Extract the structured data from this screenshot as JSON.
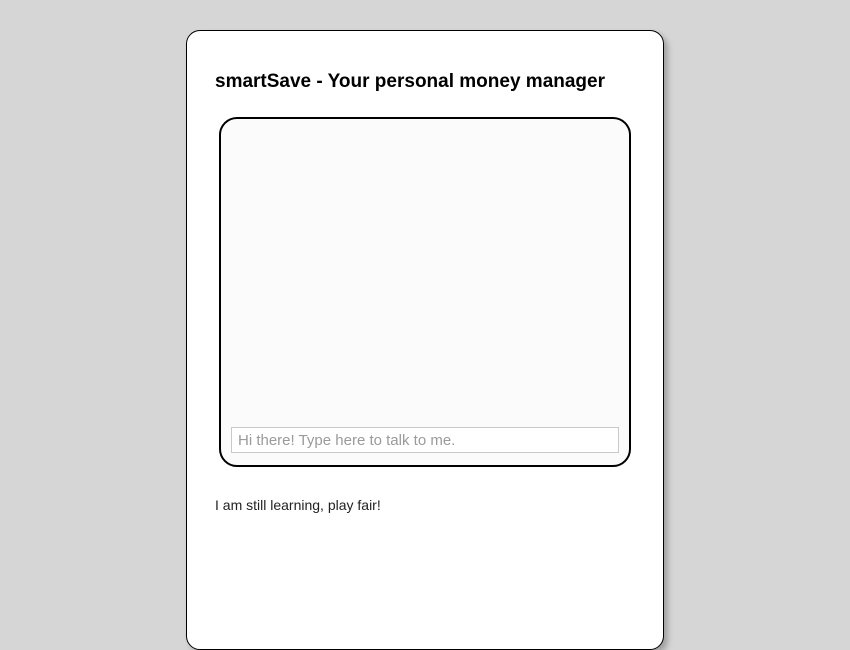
{
  "header": {
    "title": "smartSave - Your personal money manager"
  },
  "chat": {
    "input_placeholder": "Hi there! Type here to talk to me."
  },
  "footer": {
    "note": "I am still learning, play fair!"
  }
}
